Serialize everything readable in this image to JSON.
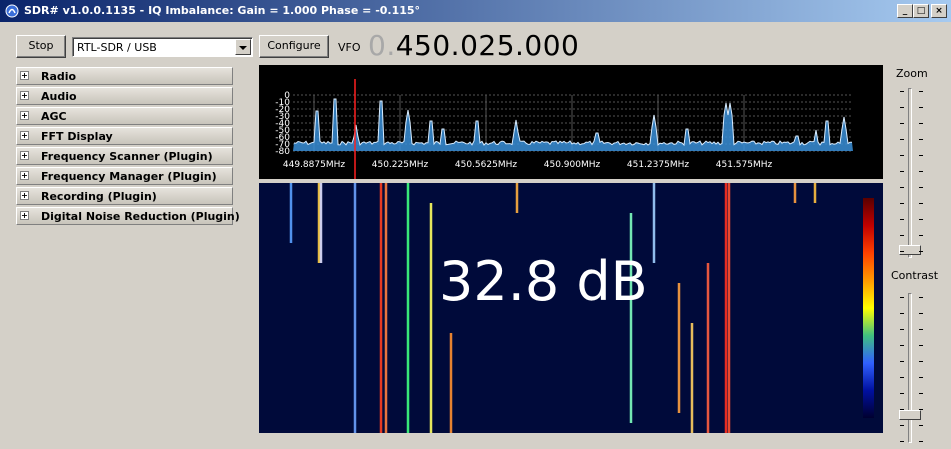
{
  "window": {
    "title": "SDR# v1.0.0.1135 - IQ Imbalance: Gain = 1.000 Phase = -0.115°",
    "minimize_glyph": "_",
    "maximize_glyph": "□",
    "close_glyph": "×"
  },
  "toolbar": {
    "stop_label": "Stop",
    "device_value": "RTL-SDR / USB",
    "configure_label": "Configure",
    "vfo_label": "VFO",
    "vfo_lead": "0.",
    "vfo_value": "450.025.000"
  },
  "panels": [
    {
      "label": "Radio"
    },
    {
      "label": "Audio"
    },
    {
      "label": "AGC"
    },
    {
      "label": "FFT Display"
    },
    {
      "label": "Frequency Scanner (Plugin)"
    },
    {
      "label": "Frequency Manager (Plugin)"
    },
    {
      "label": "Recording (Plugin)"
    },
    {
      "label": "Digital Noise Reduction (Plugin)"
    }
  ],
  "spectrum": {
    "db_labels": [
      "0",
      "-10",
      "-20",
      "-30",
      "-40",
      "-50",
      "-60",
      "-70",
      "-80"
    ],
    "freq_labels": [
      "449.8875MHz",
      "450.225MHz",
      "450.5625MHz",
      "450.900MHz",
      "451.2375MHz",
      "451.575MHz"
    ],
    "trace_color": "#3a8fd8",
    "marker_color": "#ff2020"
  },
  "waterfall": {
    "snr_text": "32.8 dB"
  },
  "sliders": {
    "zoom_label": "Zoom",
    "contrast_label": "Contrast"
  },
  "icons": {
    "app": "sdr-app-icon",
    "expand": "plus-icon",
    "dropdown": "chevron-down-icon"
  }
}
